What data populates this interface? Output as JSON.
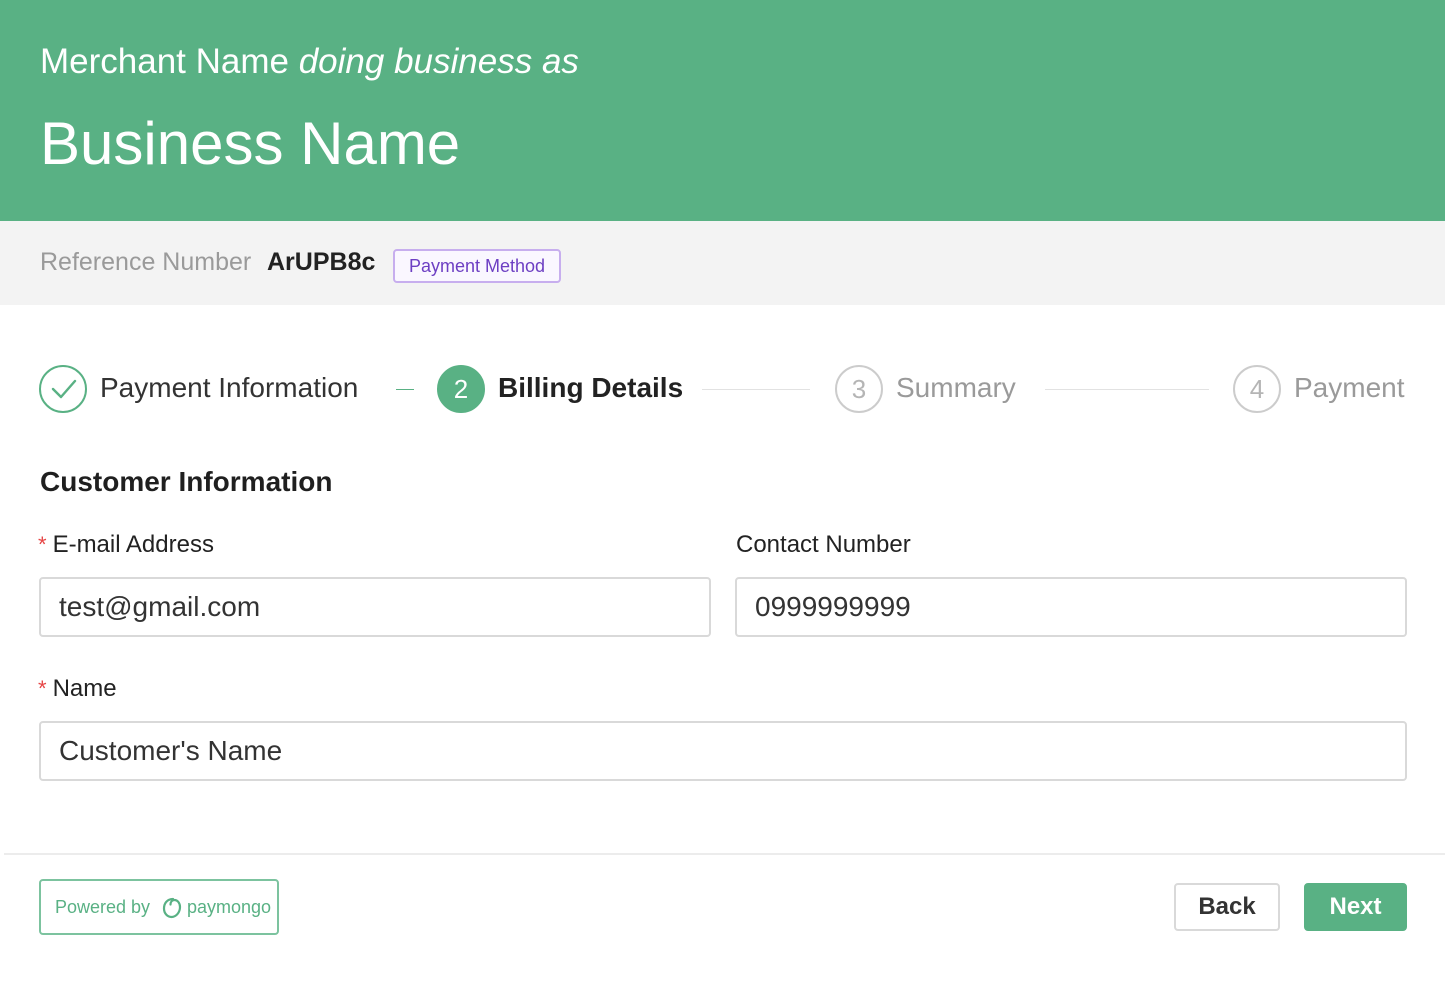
{
  "header": {
    "merchant_name": "Merchant Name",
    "dba": "doing business as",
    "business_name": "Business Name"
  },
  "reference": {
    "label": "Reference Number",
    "value": "ArUPB8c",
    "badge": "Payment Method"
  },
  "steps": [
    {
      "number": "1",
      "label": "Payment Information",
      "state": "done"
    },
    {
      "number": "2",
      "label": "Billing Details",
      "state": "active"
    },
    {
      "number": "3",
      "label": "Summary",
      "state": "pending"
    },
    {
      "number": "4",
      "label": "Payment",
      "state": "pending"
    }
  ],
  "form": {
    "section_title": "Customer Information",
    "required_mark": "*",
    "email": {
      "label": "E-mail Address",
      "value": "test@gmail.com"
    },
    "contact": {
      "label": "Contact Number",
      "value": "0999999999"
    },
    "name": {
      "label": "Name",
      "value": "Customer's Name"
    }
  },
  "footer": {
    "powered_by": "Powered by",
    "brand": "paymongo",
    "back_label": "Back",
    "next_label": "Next"
  },
  "icons": {
    "step_done": "checkmark-icon",
    "brand_logo": "paymongo-logo-icon"
  },
  "colors": {
    "brand_green": "#59b184",
    "badge_purple": "#6d3fc3",
    "required_red": "#e64545"
  }
}
